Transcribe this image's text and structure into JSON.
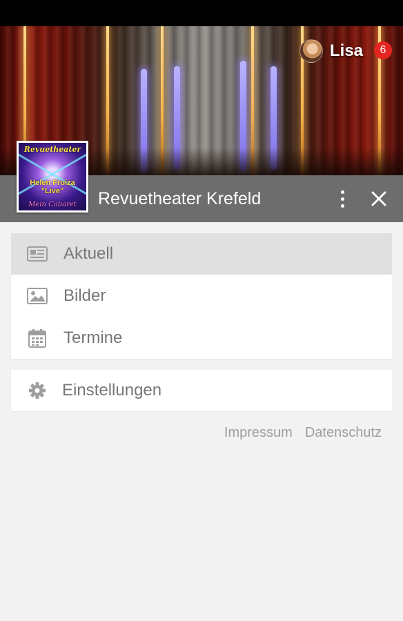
{
  "header": {
    "user_name": "Lisa",
    "notification_count": "6",
    "page_title": "Revuetheater Krefeld"
  },
  "thumbnail": {
    "line1": "Revuetheater",
    "line2": "Helen Froiza",
    "line3": "\"Live\"",
    "line4": "Mein Cabaret"
  },
  "nav": {
    "items": [
      {
        "label": "Aktuell",
        "icon": "newspaper-icon",
        "active": true
      },
      {
        "label": "Bilder",
        "icon": "image-icon",
        "active": false
      },
      {
        "label": "Termine",
        "icon": "calendar-icon",
        "active": false
      }
    ]
  },
  "settings": {
    "label": "Einstellungen",
    "icon": "gear-icon"
  },
  "footer": {
    "impressum": "Impressum",
    "datenschutz": "Datenschutz"
  },
  "colors": {
    "title_bar": "#6d6d6d",
    "active_item": "#e0e0e0",
    "badge": "#e52521",
    "background": "#f2f2f2",
    "icon_gray": "#9e9e9e"
  }
}
